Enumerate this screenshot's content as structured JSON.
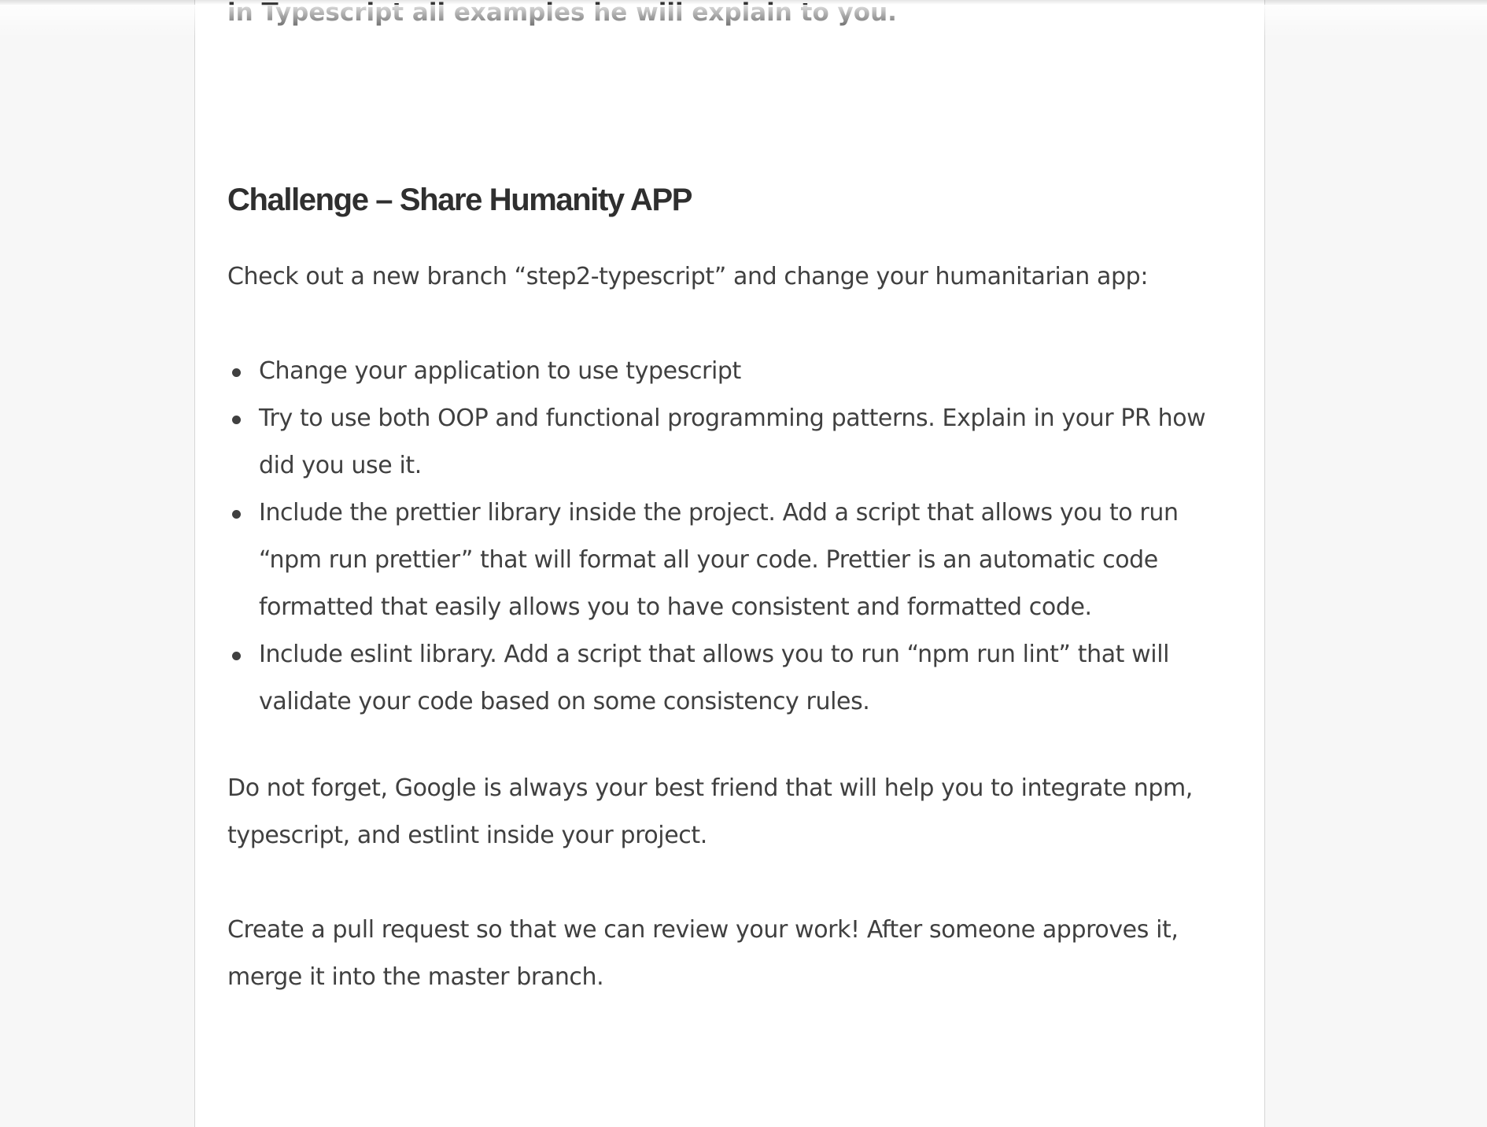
{
  "article": {
    "intro_tail": "in Typescript all examples he will explain to you.",
    "challenge": {
      "title": "Challenge – Share Humanity APP",
      "lead": "Check out a new branch “step2-typescript” and change your humanitarian app:",
      "tasks": [
        "Change your application to use typescript",
        "Try to use both OOP and functional programming patterns. Explain in your PR how did you use it.",
        "Include the prettier library inside the project. Add a script that allows you to run “npm run prettier” that will format all your code. Prettier is an automatic code formatted that easily allows you to have consistent and formatted code.",
        "Include eslint library. Add a script that allows you to run “npm run lint” that will validate your code based on some consistency rules."
      ],
      "reminder": "Do not forget, Google is always your best friend that will help you to integrate npm, typescript, and estlint inside your project.",
      "closing": "Create a pull request so that we can review your work! After someone approves it, merge it into the master branch."
    }
  }
}
